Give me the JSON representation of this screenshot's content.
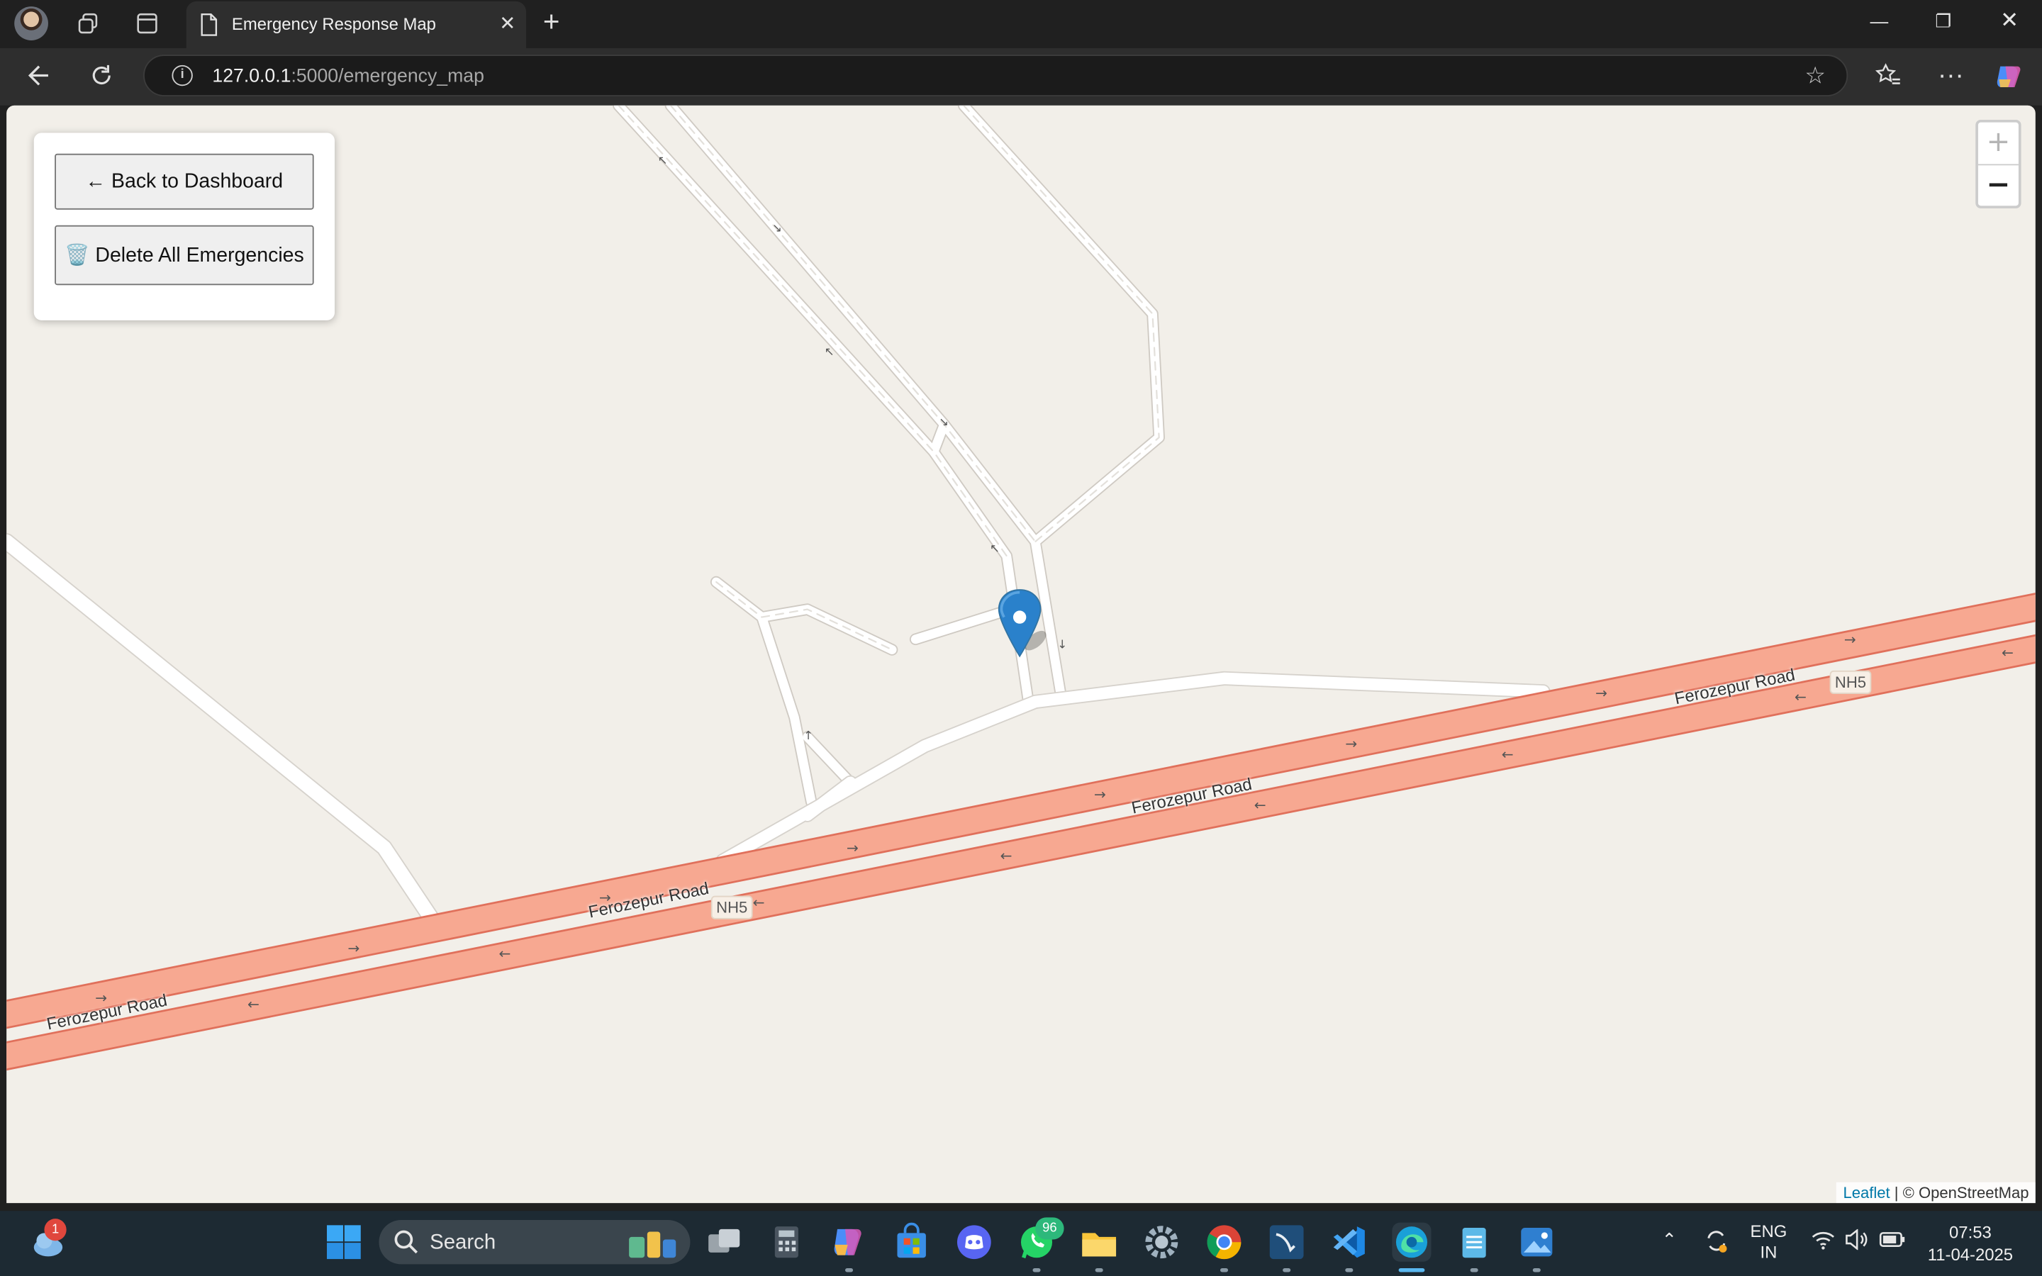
{
  "browser": {
    "tab_title": "Emergency Response Map",
    "url_host": "127.0.0.1",
    "url_rest": ":5000/emergency_map"
  },
  "controls": {
    "back_label": "← Back to Dashboard",
    "delete_label": "🗑️ Delete All Emergencies"
  },
  "map": {
    "zoom_in": "+",
    "zoom_out": "−",
    "labels": {
      "road_1": "Ferozepur Road",
      "road_2": "Ferozepur Road",
      "road_3": "Ferozepur Road",
      "road_4": "Ferozepur Road",
      "shield_1": "NH5",
      "shield_2": "NH5"
    },
    "attribution_link": "Leaflet",
    "attribution_text": " | © OpenStreetMap",
    "colors": {
      "primary_road": "#f6a58f",
      "primary_casing": "#e0705b",
      "land": "#f2efe9",
      "marker": "#2a81cb"
    }
  },
  "taskbar": {
    "search_placeholder": "Search",
    "weather_badge": "1",
    "whatsapp_badge": "96",
    "lang_top": "ENG",
    "lang_bottom": "IN",
    "time": "07:53",
    "date": "11-04-2025",
    "icons": [
      "windows-start-icon",
      "search-icon",
      "task-view-icon",
      "calculator-icon",
      "copilot-icon",
      "store-icon",
      "discord-icon",
      "whatsapp-icon",
      "file-explorer-icon",
      "settings-icon",
      "chrome-icon",
      "mysql-workbench-icon",
      "vscode-icon",
      "edge-icon",
      "notepad-icon",
      "photos-icon"
    ]
  }
}
